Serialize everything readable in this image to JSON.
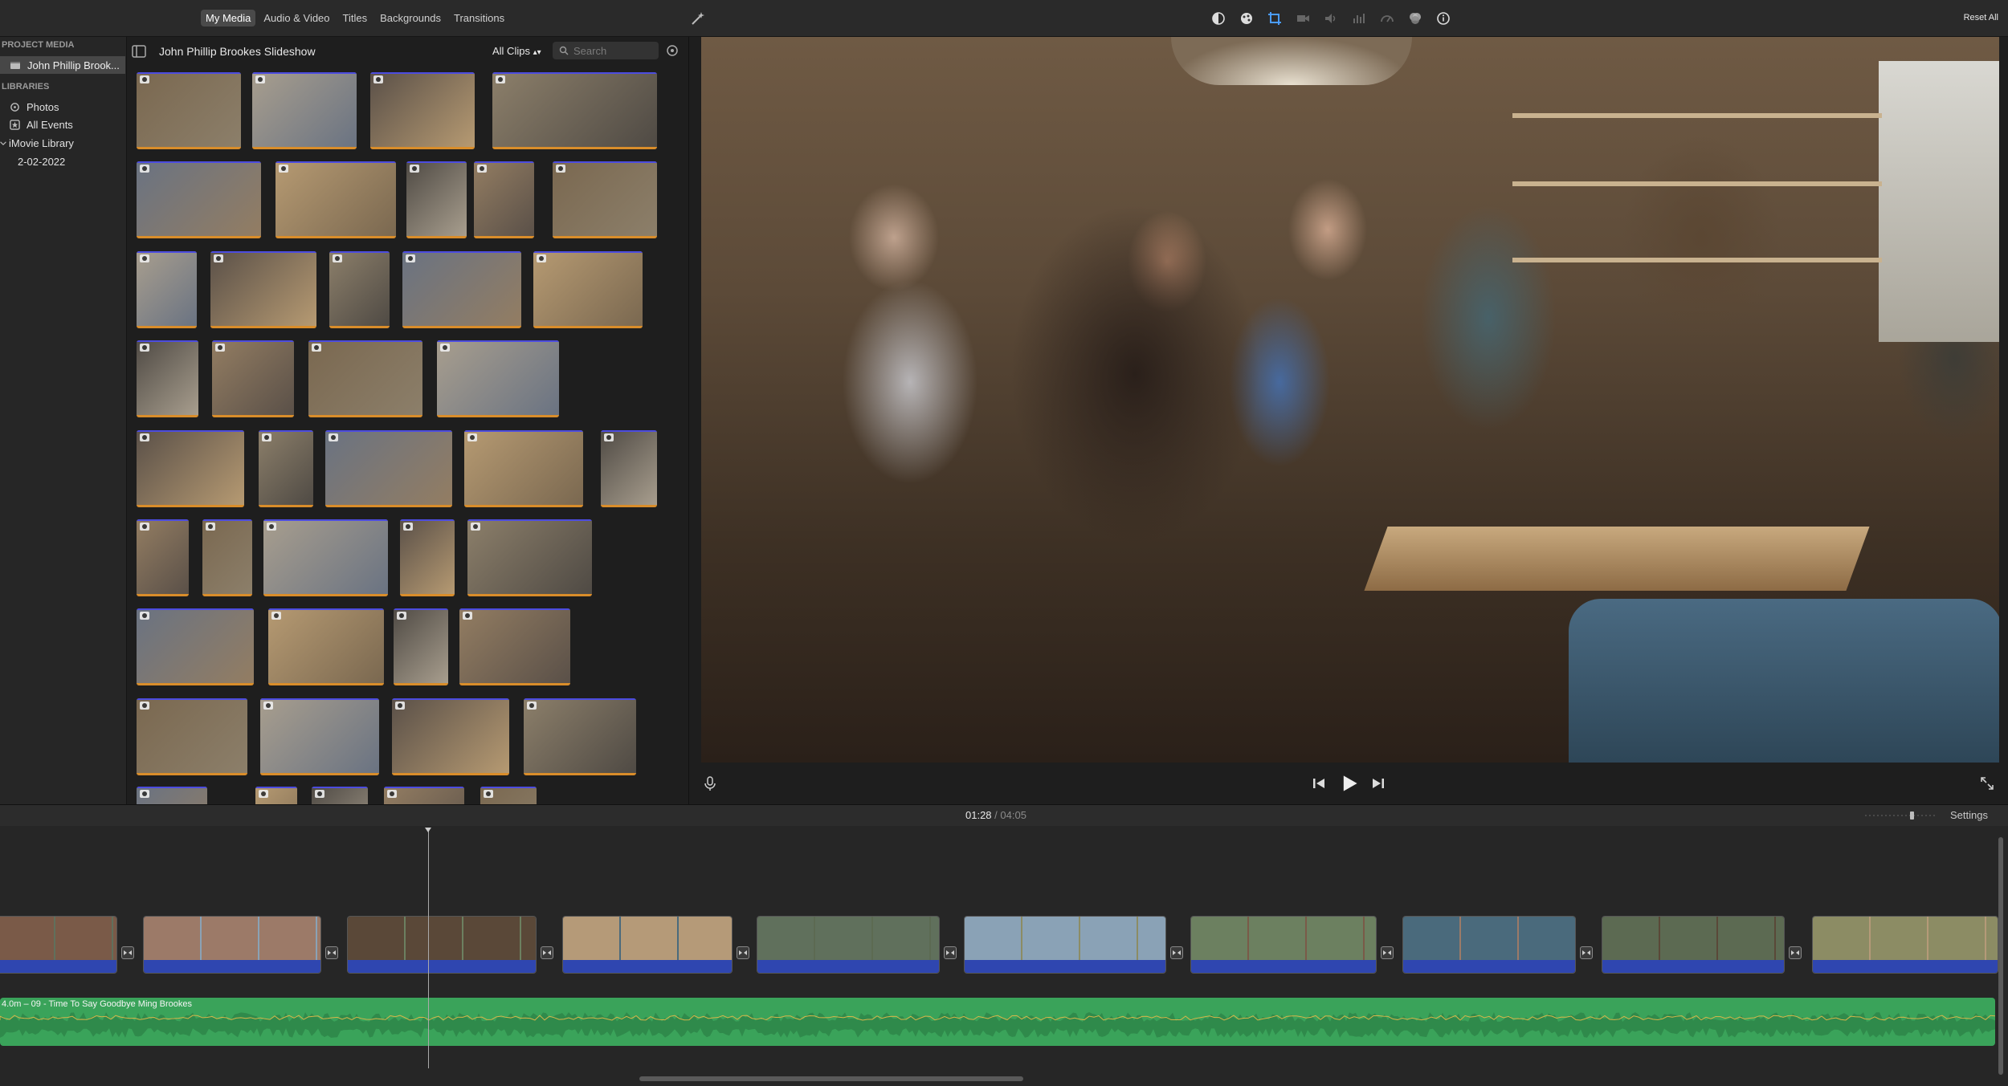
{
  "toolbar": {
    "media_tabs": [
      "My Media",
      "Audio & Video",
      "Titles",
      "Backgrounds",
      "Transitions"
    ],
    "active_tab": "My Media",
    "reset_all_label": "Reset All",
    "tool_icons": [
      "color-balance-icon",
      "color-correction-icon",
      "crop-icon",
      "stabilization-icon",
      "volume-icon",
      "noise-reduction-icon",
      "speed-icon",
      "clip-filter-icon",
      "info-icon"
    ]
  },
  "sidebar": {
    "project_media_heading": "PROJECT MEDIA",
    "project_item": "John Phillip Brook...",
    "libraries_heading": "LIBRARIES",
    "library_items": [
      "Photos",
      "All Events"
    ],
    "library_name": "iMovie Library",
    "event": "2-02-2022"
  },
  "browser": {
    "title": "John Phillip Brookes Slideshow",
    "filter_label": "All Clips",
    "search_placeholder": "Search"
  },
  "timeline": {
    "current_time": "01:28",
    "separator": "/",
    "total_time": "04:05",
    "settings_label": "Settings",
    "audio_clip_label": "4.0m – 09 - Time To Say Goodbye Ming Brookes"
  },
  "colors": {
    "audio_green": "#3aa35a",
    "clip_blue": "#2f46b0",
    "favorite_orange": "#d98d2a"
  }
}
